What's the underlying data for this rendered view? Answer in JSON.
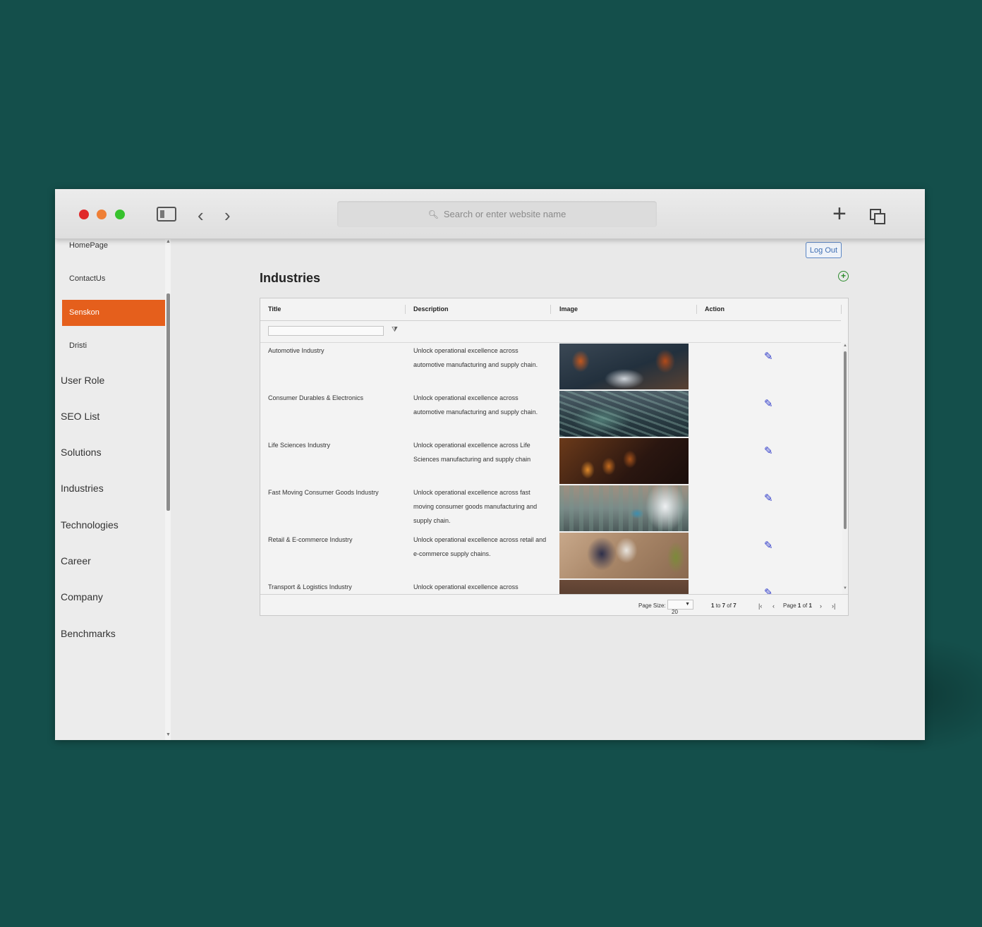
{
  "browser": {
    "address_placeholder": "Search or enter website name"
  },
  "sidebar": {
    "items": [
      {
        "label": "HomePage"
      },
      {
        "label": "ContactUs"
      },
      {
        "label": "Senskon",
        "active": true
      },
      {
        "label": "Dristi"
      },
      {
        "label": "User Role"
      },
      {
        "label": "SEO List"
      },
      {
        "label": "Solutions"
      },
      {
        "label": "Industries"
      },
      {
        "label": "Technologies"
      },
      {
        "label": "Career"
      },
      {
        "label": "Company"
      },
      {
        "label": "Benchmarks"
      }
    ]
  },
  "header": {
    "logout_label": "Log Out",
    "page_title": "Industries"
  },
  "table": {
    "columns": [
      "Title",
      "Description",
      "Image",
      "Action"
    ],
    "rows": [
      {
        "title": "Automotive Industry",
        "description": "Unlock operational excellence across automotive manufacturing and supply chain."
      },
      {
        "title": "Consumer Durables & Electronics",
        "description": "Unlock operational excellence across automotive manufacturing and supply chain."
      },
      {
        "title": "Life Sciences Industry",
        "description": "Unlock operational excellence across Life Sciences manufacturing and supply chain"
      },
      {
        "title": "Fast Moving Consumer Goods Industry",
        "description": "Unlock operational excellence across fast moving consumer goods manufacturing and supply chain."
      },
      {
        "title": "Retail & E-commerce Industry",
        "description": "Unlock operational excellence across retail and e-commerce supply chains."
      },
      {
        "title": "Transport & Logistics Industry",
        "description": "Unlock operational excellence across"
      }
    ],
    "footer": {
      "page_size_label": "Page Size:",
      "page_size_value": "20",
      "range_from": "1",
      "range_to": "7",
      "range_total": "7",
      "to_word": "to",
      "of_word": "of",
      "page_word": "Page",
      "page_current": "1",
      "page_total": "1"
    }
  },
  "colors": {
    "background": "#144f4b",
    "active_item": "#e55f1c",
    "edit_icon": "#2b37c9",
    "add_icon": "#2a8a2a",
    "logout_border": "#5b86c4"
  }
}
